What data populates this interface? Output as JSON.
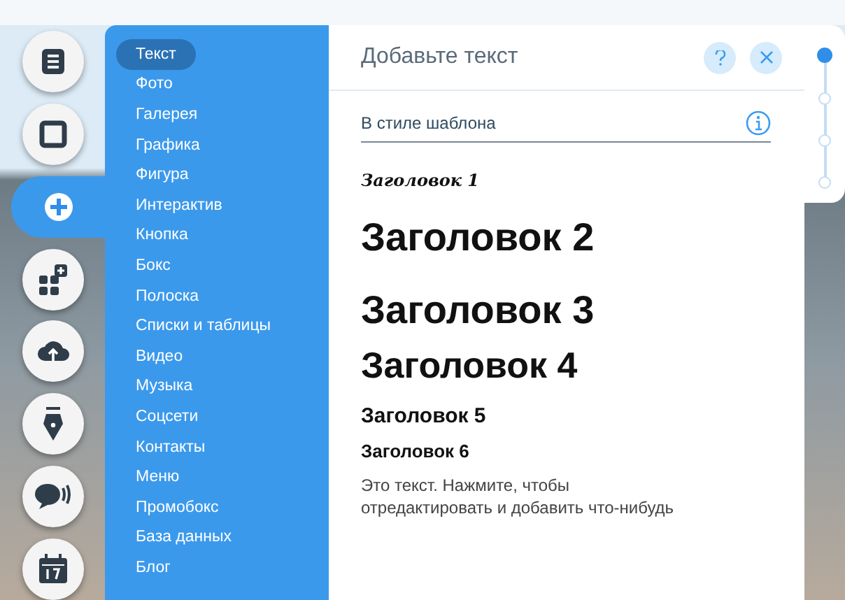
{
  "toolbar": [
    {
      "kind": "pages",
      "selected": false
    },
    {
      "kind": "background",
      "selected": false
    },
    {
      "kind": "add",
      "selected": true
    },
    {
      "kind": "apps",
      "selected": false
    },
    {
      "kind": "upload",
      "selected": false
    },
    {
      "kind": "pen",
      "selected": false
    },
    {
      "kind": "chat",
      "selected": false
    },
    {
      "kind": "calendar",
      "selected": false
    }
  ],
  "menu": [
    {
      "label": "Текст",
      "selected": true
    },
    {
      "label": "Фото",
      "selected": false
    },
    {
      "label": "Галерея",
      "selected": false
    },
    {
      "label": "Графика",
      "selected": false
    },
    {
      "label": "Фигура",
      "selected": false
    },
    {
      "label": "Интерактив",
      "selected": false
    },
    {
      "label": "Кнопка",
      "selected": false
    },
    {
      "label": "Бокс",
      "selected": false
    },
    {
      "label": "Полоска",
      "selected": false
    },
    {
      "label": "Списки и таблицы",
      "selected": false
    },
    {
      "label": "Видео",
      "selected": false
    },
    {
      "label": "Музыка",
      "selected": false
    },
    {
      "label": "Соцсети",
      "selected": false
    },
    {
      "label": "Контакты",
      "selected": false
    },
    {
      "label": "Меню",
      "selected": false
    },
    {
      "label": "Промобокс",
      "selected": false
    },
    {
      "label": "База данных",
      "selected": false
    },
    {
      "label": "Блог",
      "selected": false
    }
  ],
  "panel": {
    "title": "Добавьте текст",
    "section": "В стиле шаблона",
    "items": [
      {
        "kind": "h1",
        "text": "Заголовок 1"
      },
      {
        "kind": "h2",
        "text": "Заголовок 2"
      },
      {
        "kind": "h3",
        "text": "Заголовок 3"
      },
      {
        "kind": "h4",
        "text": "Заголовок 4"
      },
      {
        "kind": "h5",
        "text": "Заголовок 5"
      },
      {
        "kind": "h6",
        "text": "Заголовок 6"
      },
      {
        "kind": "p",
        "text": "Это текст. Нажмите, чтобы отредактировать и добавить что-нибудь"
      }
    ]
  },
  "steps": [
    {
      "selected": true
    },
    {
      "selected": false
    },
    {
      "selected": false
    },
    {
      "selected": false
    }
  ]
}
